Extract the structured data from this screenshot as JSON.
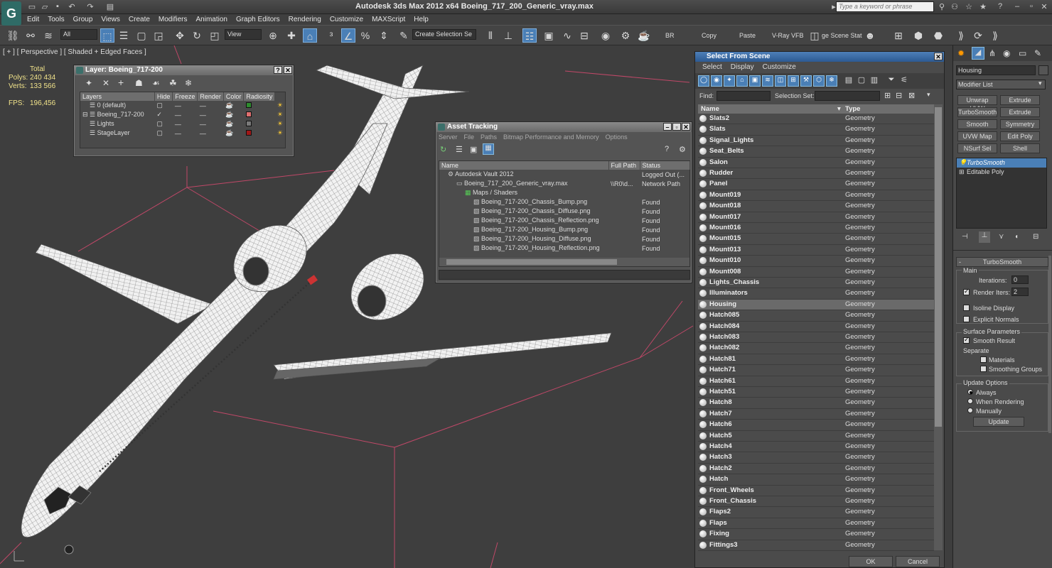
{
  "app": {
    "title": "Autodesk 3ds Max  2012 x64     Boeing_717_200_Generic_vray.max",
    "search_placeholder": "Type a keyword or phrase"
  },
  "menu": [
    "Edit",
    "Tools",
    "Group",
    "Views",
    "Create",
    "Modifiers",
    "Animation",
    "Graph Editors",
    "Rendering",
    "Customize",
    "MAXScript",
    "Help"
  ],
  "toolbar": {
    "filter": "All",
    "refcoord": "View",
    "selection_set": "Create Selection Se",
    "labels": [
      "BR",
      "Copy",
      "Paste",
      "V-Ray VFB",
      "ge Scene Stat"
    ]
  },
  "viewport": {
    "label": "[ + ] [ Perspective ] [ Shaded + Edged Faces ]",
    "stats": {
      "total": "Total",
      "polys_label": "Polys:",
      "polys": "240 434",
      "verts_label": "Verts:",
      "verts": "133 566",
      "fps_label": "FPS:",
      "fps": "196,456"
    }
  },
  "layer_window": {
    "title": "Layer: Boeing_717-200",
    "columns": [
      "Layers",
      "Hide",
      "Freeze",
      "Render",
      "Color",
      "Radiosity"
    ],
    "rows": [
      {
        "name": "0 (default)",
        "color": "#2e8b2e",
        "active": false
      },
      {
        "name": "Boeing_717-200",
        "color": "#e07070",
        "active": true
      },
      {
        "name": "Lights",
        "color": "#7a7a7a",
        "active": false
      },
      {
        "name": "StageLayer",
        "color": "#a01818",
        "active": false
      }
    ]
  },
  "asset_tracking": {
    "title": "Asset Tracking",
    "menu": [
      "Server",
      "File",
      "Paths",
      "Bitmap Performance and Memory",
      "Options"
    ],
    "columns": [
      "Name",
      "Full Path",
      "Status"
    ],
    "rows": [
      {
        "name": "Autodesk Vault 2012",
        "path": "",
        "status": "Logged Out (...",
        "indent": 1
      },
      {
        "name": "Boeing_717_200_Generic_vray.max",
        "path": "\\\\R0\\d...",
        "status": "Network Path",
        "indent": 2
      },
      {
        "name": "Maps / Shaders",
        "path": "",
        "status": "",
        "indent": 3
      },
      {
        "name": "Boeing_717-200_Chassis_Bump.png",
        "path": "",
        "status": "Found",
        "indent": 4
      },
      {
        "name": "Boeing_717-200_Chassis_Diffuse.png",
        "path": "",
        "status": "Found",
        "indent": 4
      },
      {
        "name": "Boeing_717-200_Chassis_Reflection.png",
        "path": "",
        "status": "Found",
        "indent": 4
      },
      {
        "name": "Boeing_717-200_Housing_Bump.png",
        "path": "",
        "status": "Found",
        "indent": 4
      },
      {
        "name": "Boeing_717-200_Housing_Diffuse.png",
        "path": "",
        "status": "Found",
        "indent": 4
      },
      {
        "name": "Boeing_717-200_Housing_Reflection.png",
        "path": "",
        "status": "Found",
        "indent": 4
      }
    ]
  },
  "select_from_scene": {
    "title": "Select From Scene",
    "menu": [
      "Select",
      "Display",
      "Customize"
    ],
    "find_label": "Find:",
    "selection_set_label": "Selection Set:",
    "columns": [
      "Name",
      "Type"
    ],
    "rows": [
      {
        "name": "Slats2",
        "type": "Geometry"
      },
      {
        "name": "Slats",
        "type": "Geometry"
      },
      {
        "name": "Signal_Lights",
        "type": "Geometry"
      },
      {
        "name": "Seat_Belts",
        "type": "Geometry"
      },
      {
        "name": "Salon",
        "type": "Geometry"
      },
      {
        "name": "Rudder",
        "type": "Geometry"
      },
      {
        "name": "Panel",
        "type": "Geometry"
      },
      {
        "name": "Mount019",
        "type": "Geometry"
      },
      {
        "name": "Mount018",
        "type": "Geometry"
      },
      {
        "name": "Mount017",
        "type": "Geometry"
      },
      {
        "name": "Mount016",
        "type": "Geometry"
      },
      {
        "name": "Mount015",
        "type": "Geometry"
      },
      {
        "name": "Mount013",
        "type": "Geometry"
      },
      {
        "name": "Mount010",
        "type": "Geometry"
      },
      {
        "name": "Mount008",
        "type": "Geometry"
      },
      {
        "name": "Lights_Chassis",
        "type": "Geometry"
      },
      {
        "name": "Illuminators",
        "type": "Geometry"
      },
      {
        "name": "Housing",
        "type": "Geometry",
        "selected": true
      },
      {
        "name": "Hatch085",
        "type": "Geometry"
      },
      {
        "name": "Hatch084",
        "type": "Geometry"
      },
      {
        "name": "Hatch083",
        "type": "Geometry"
      },
      {
        "name": "Hatch082",
        "type": "Geometry"
      },
      {
        "name": "Hatch81",
        "type": "Geometry"
      },
      {
        "name": "Hatch71",
        "type": "Geometry"
      },
      {
        "name": "Hatch61",
        "type": "Geometry"
      },
      {
        "name": "Hatch51",
        "type": "Geometry"
      },
      {
        "name": "Hatch8",
        "type": "Geometry"
      },
      {
        "name": "Hatch7",
        "type": "Geometry"
      },
      {
        "name": "Hatch6",
        "type": "Geometry"
      },
      {
        "name": "Hatch5",
        "type": "Geometry"
      },
      {
        "name": "Hatch4",
        "type": "Geometry"
      },
      {
        "name": "Hatch3",
        "type": "Geometry"
      },
      {
        "name": "Hatch2",
        "type": "Geometry"
      },
      {
        "name": "Hatch",
        "type": "Geometry"
      },
      {
        "name": "Front_Wheels",
        "type": "Geometry"
      },
      {
        "name": "Front_Chassis",
        "type": "Geometry"
      },
      {
        "name": "Flaps2",
        "type": "Geometry"
      },
      {
        "name": "Flaps",
        "type": "Geometry"
      },
      {
        "name": "Fixing",
        "type": "Geometry"
      },
      {
        "name": "Fittings3",
        "type": "Geometry"
      }
    ],
    "ok": "OK",
    "cancel": "Cancel"
  },
  "command_panel": {
    "object_name": "Housing",
    "modifier_list": "Modifier List",
    "buttons": [
      "Unwrap UVW",
      "Extrude",
      "TurboSmooth",
      "Extrude",
      "Smooth",
      "Symmetry",
      "UVW Map",
      "Edit Poly",
      "NSurf Sel",
      "Shell"
    ],
    "stack": [
      "TurboSmooth",
      "Editable Poly"
    ],
    "rollout_title": "TurboSmooth",
    "main_label": "Main",
    "iterations_label": "Iterations:",
    "iterations": "0",
    "render_iters_label": "Render Iters:",
    "render_iters": "2",
    "isoline": "Isoline Display",
    "explicit": "Explicit Normals",
    "surface_params": "Surface Parameters",
    "smooth_result": "Smooth Result",
    "separate": "Separate",
    "materials": "Materials",
    "smoothing_groups": "Smoothing Groups",
    "update_options": "Update Options",
    "always": "Always",
    "when_rendering": "When Rendering",
    "manually": "Manually",
    "update": "Update"
  },
  "colors": {
    "accent": "#4a7fb6",
    "selected_row": "#6a6a6a",
    "wire": "#e8e8e8"
  }
}
